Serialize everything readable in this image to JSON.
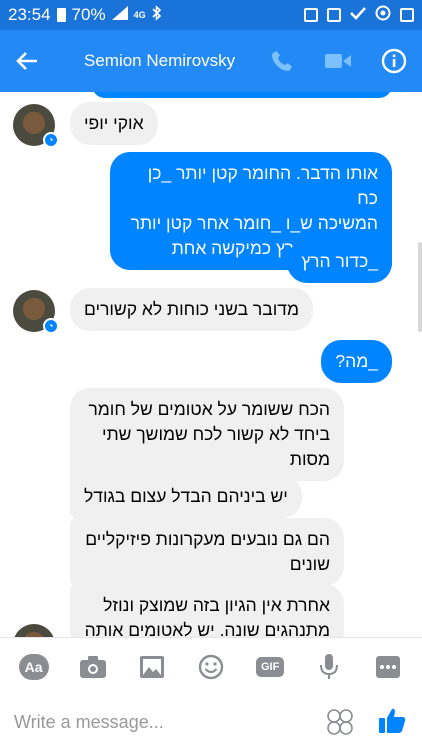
{
  "status": {
    "time": "23:54",
    "battery": "70%",
    "network": "4G"
  },
  "header": {
    "title": "Semion Nemirovsky",
    "accent": "#2389f5"
  },
  "messages": [
    {
      "dir": "in",
      "text": "אוקי יופי"
    },
    {
      "dir": "out",
      "lines": [
        "אותו הדבר. החומר קטן יותר _כן כח",
        "המשיכה ש_ו _חומר אחר קטן יותר",
        "גם כדור הארץ כמיקשה אחת"
      ]
    },
    {
      "dir": "out",
      "text": "_כדור הרץ"
    },
    {
      "dir": "in",
      "text": "מדובר בשני כוחות לא קשורים"
    },
    {
      "dir": "out",
      "text": "_מה?"
    },
    {
      "dir": "in",
      "lines": [
        "הכח ששומר על אטומים של חומר",
        "ביחד לא קשור לכח שמושך שתי",
        "מסות"
      ]
    },
    {
      "dir": "in",
      "text": "יש ביניהם הבדל עצום בגודל"
    },
    {
      "dir": "in",
      "lines": [
        "הם גם נובעים מעקרונות פיזיקליים",
        "שונים"
      ]
    },
    {
      "dir": "in",
      "lines": [
        "אחרת אין הגיון בזה שמוצק ונוזל",
        "מתנהגים שונה. יש לאטומים אותה"
      ]
    }
  ],
  "composer": {
    "aa_label": "Aa",
    "gif_label": "GIF",
    "placeholder": "Write a message..."
  }
}
